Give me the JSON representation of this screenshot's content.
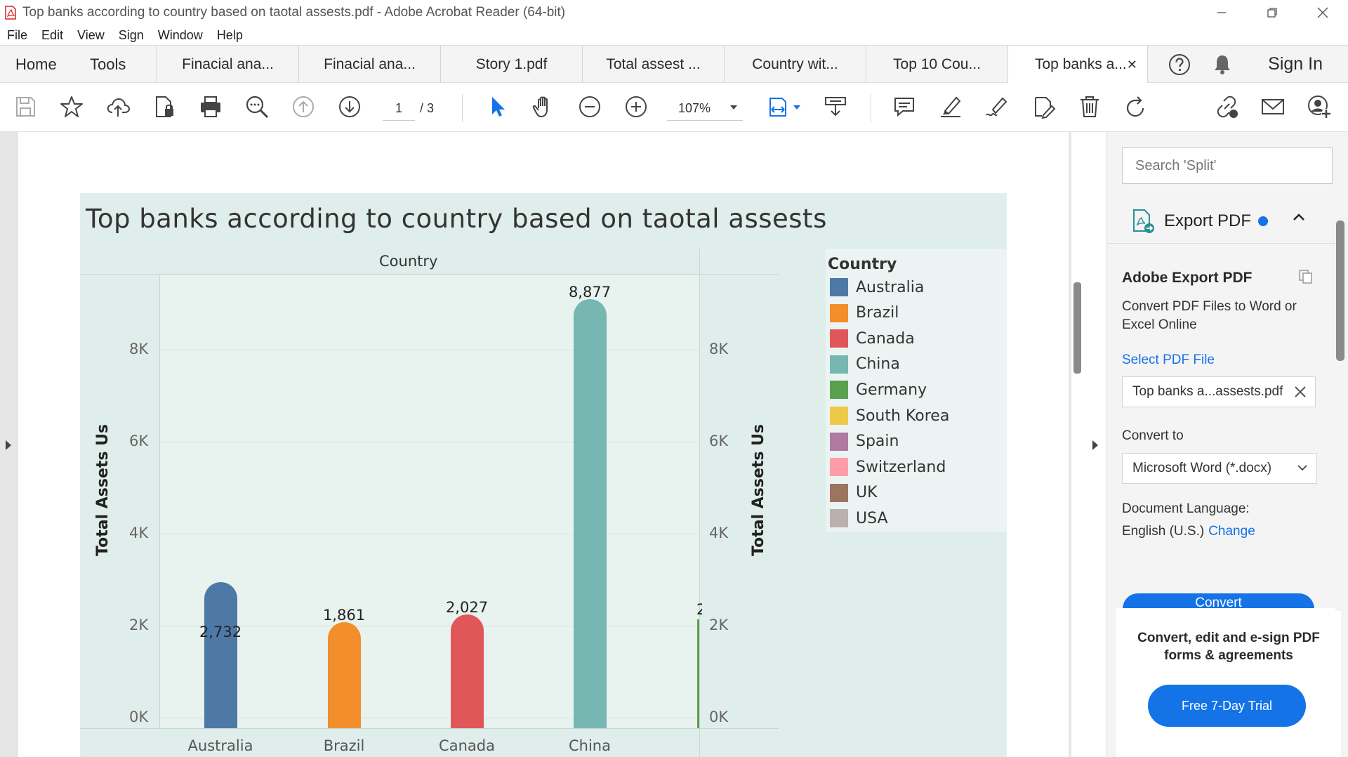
{
  "window": {
    "title": "Top banks according to country based on taotal assests.pdf - Adobe Acrobat Reader (64-bit)"
  },
  "menu": [
    "File",
    "Edit",
    "View",
    "Sign",
    "Window",
    "Help"
  ],
  "tabs": {
    "home": "Home",
    "tools": "Tools",
    "documents": [
      {
        "label": "Finacial ana...",
        "active": false
      },
      {
        "label": "Finacial ana...",
        "active": false
      },
      {
        "label": "Story 1.pdf",
        "active": false
      },
      {
        "label": "Total assest ...",
        "active": false
      },
      {
        "label": "Country wit...",
        "active": false
      },
      {
        "label": "Top 10 Cou...",
        "active": false
      },
      {
        "label": "Top banks a...",
        "active": true
      }
    ],
    "close_glyph": "✕",
    "sign_in": "Sign In"
  },
  "toolbar": {
    "page_current": "1",
    "page_total": "/ 3",
    "zoom": "107%"
  },
  "chart_data": {
    "type": "bar",
    "title": "Top banks according to country based on taotal assests",
    "column_header": "Country",
    "ylabel_left": "Total Assets Us",
    "ylabel_right": "Total Assets Us",
    "ylim": [
      0,
      9700
    ],
    "yticks": [
      0,
      2000,
      4000,
      6000,
      8000
    ],
    "ytick_labels": [
      "0K",
      "2K",
      "4K",
      "6K",
      "8K"
    ],
    "categories": [
      "Australia",
      "Brazil",
      "Canada",
      "China"
    ],
    "values": [
      2732,
      1861,
      2027,
      8877
    ],
    "value_labels": [
      "2,732",
      "1,861",
      "2,027",
      "8,877"
    ],
    "colors": [
      "#4e79a7",
      "#f28e2b",
      "#e15759",
      "#76b7b2"
    ],
    "clipped_label": "2",
    "legend": {
      "title": "Country",
      "entries": [
        {
          "name": "Australia",
          "color": "#4e79a7"
        },
        {
          "name": "Brazil",
          "color": "#f28e2b"
        },
        {
          "name": "Canada",
          "color": "#e15759"
        },
        {
          "name": "China",
          "color": "#76b7b2"
        },
        {
          "name": "Germany",
          "color": "#59a14f"
        },
        {
          "name": "South Korea",
          "color": "#edc948"
        },
        {
          "name": "Spain",
          "color": "#b07aa1"
        },
        {
          "name": "Switzerland",
          "color": "#ff9da7"
        },
        {
          "name": "UK",
          "color": "#9c755f"
        },
        {
          "name": "USA",
          "color": "#bab0ac"
        }
      ]
    }
  },
  "panel": {
    "search_placeholder": "Search 'Split'",
    "export_title": "Export PDF",
    "heading": "Adobe Export PDF",
    "description": "Convert PDF Files to Word or Excel Online",
    "select_link": "Select PDF File",
    "file_name": "Top banks a...assests.pdf",
    "convert_to_label": "Convert to",
    "convert_to_value": "Microsoft Word (*.docx)",
    "doc_lang_label": "Document Language:",
    "doc_lang_value": "English (U.S.)",
    "change_link": "Change",
    "convert_button": "Convert",
    "promo_text": "Convert, edit and e-sign PDF forms & agreements",
    "trial_button": "Free 7-Day Trial"
  },
  "colors": {
    "accent": "#1473e6",
    "chart_bg": "#e0eeeb"
  }
}
